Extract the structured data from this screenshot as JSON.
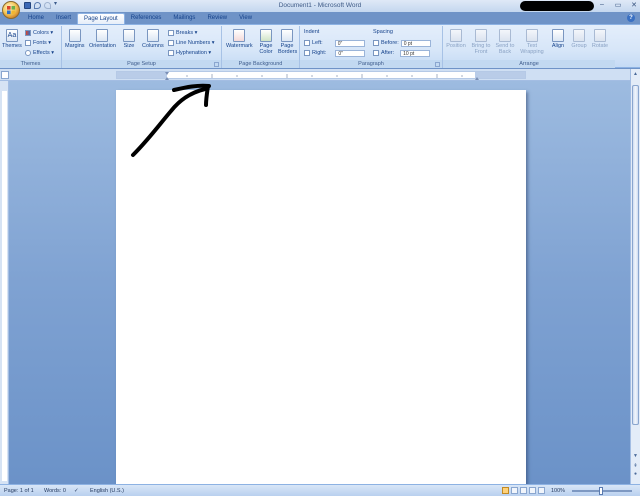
{
  "window": {
    "title": "Document1 - Microsoft Word",
    "controls": [
      "–",
      "▭",
      "✕"
    ]
  },
  "quick_access": {
    "save_icon": "save-icon",
    "undo_icon": "undo-icon",
    "redo_icon": "redo-icon",
    "customize": "▾"
  },
  "tabs": [
    {
      "label": "Home",
      "active": false
    },
    {
      "label": "Insert",
      "active": false
    },
    {
      "label": "Page Layout",
      "active": true
    },
    {
      "label": "References",
      "active": false
    },
    {
      "label": "Mailings",
      "active": false
    },
    {
      "label": "Review",
      "active": false
    },
    {
      "label": "View",
      "active": false
    }
  ],
  "ribbon": {
    "themes": {
      "label": "Themes",
      "themes_btn": "Themes",
      "colors": "Colors ▾",
      "fonts": "Fonts ▾",
      "effects": "Effects ▾"
    },
    "page_setup": {
      "label": "Page Setup",
      "margins": "Margins",
      "orientation": "Orientation",
      "size": "Size",
      "columns": "Columns",
      "breaks": "Breaks ▾",
      "line_numbers": "Line Numbers ▾",
      "hyphenation": "Hyphenation ▾"
    },
    "page_background": {
      "label": "Page Background",
      "watermark": "Watermark",
      "page_color": "Page Color",
      "page_borders": "Page Borders"
    },
    "paragraph": {
      "label": "Paragraph",
      "indent_title": "Indent",
      "left_label": "Left:",
      "left_value": "0\"",
      "right_label": "Right:",
      "right_value": "0\"",
      "spacing_title": "Spacing",
      "before_label": "Before:",
      "before_value": "0 pt",
      "after_label": "After:",
      "after_value": "10 pt"
    },
    "arrange": {
      "label": "Arrange",
      "position": "Position",
      "bring_to_front": "Bring to Front",
      "send_to_back": "Send to Back",
      "text_wrapping": "Text Wrapping",
      "align": "Align",
      "group": "Group",
      "rotate": "Rotate"
    }
  },
  "status": {
    "page": "Page: 1 of 1",
    "words": "Words: 0",
    "language": "English (U.S.)",
    "zoom": "100%"
  },
  "colors": {
    "ribbon_bg": "#d7e6f8",
    "doc_bg": "#7fa2d2",
    "tab_text": "#15428b"
  }
}
